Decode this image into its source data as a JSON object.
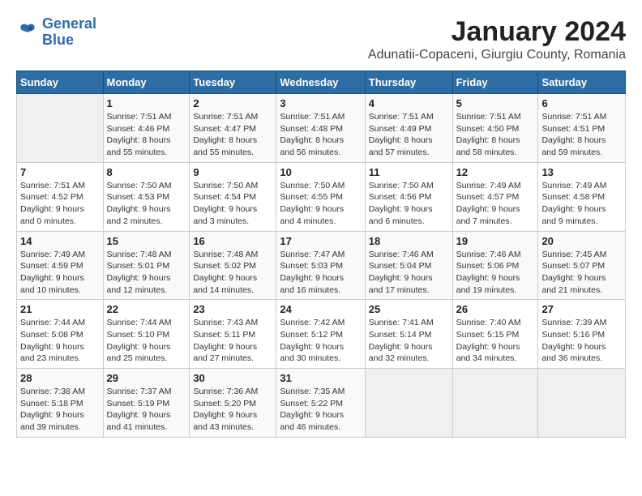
{
  "header": {
    "logo_line1": "General",
    "logo_line2": "Blue",
    "title": "January 2024",
    "subtitle": "Adunatii-Copaceni, Giurgiu County, Romania"
  },
  "weekdays": [
    "Sunday",
    "Monday",
    "Tuesday",
    "Wednesday",
    "Thursday",
    "Friday",
    "Saturday"
  ],
  "weeks": [
    [
      {
        "day": "",
        "info": ""
      },
      {
        "day": "1",
        "info": "Sunrise: 7:51 AM\nSunset: 4:46 PM\nDaylight: 8 hours\nand 55 minutes."
      },
      {
        "day": "2",
        "info": "Sunrise: 7:51 AM\nSunset: 4:47 PM\nDaylight: 8 hours\nand 55 minutes."
      },
      {
        "day": "3",
        "info": "Sunrise: 7:51 AM\nSunset: 4:48 PM\nDaylight: 8 hours\nand 56 minutes."
      },
      {
        "day": "4",
        "info": "Sunrise: 7:51 AM\nSunset: 4:49 PM\nDaylight: 8 hours\nand 57 minutes."
      },
      {
        "day": "5",
        "info": "Sunrise: 7:51 AM\nSunset: 4:50 PM\nDaylight: 8 hours\nand 58 minutes."
      },
      {
        "day": "6",
        "info": "Sunrise: 7:51 AM\nSunset: 4:51 PM\nDaylight: 8 hours\nand 59 minutes."
      }
    ],
    [
      {
        "day": "7",
        "info": "Sunrise: 7:51 AM\nSunset: 4:52 PM\nDaylight: 9 hours\nand 0 minutes."
      },
      {
        "day": "8",
        "info": "Sunrise: 7:50 AM\nSunset: 4:53 PM\nDaylight: 9 hours\nand 2 minutes."
      },
      {
        "day": "9",
        "info": "Sunrise: 7:50 AM\nSunset: 4:54 PM\nDaylight: 9 hours\nand 3 minutes."
      },
      {
        "day": "10",
        "info": "Sunrise: 7:50 AM\nSunset: 4:55 PM\nDaylight: 9 hours\nand 4 minutes."
      },
      {
        "day": "11",
        "info": "Sunrise: 7:50 AM\nSunset: 4:56 PM\nDaylight: 9 hours\nand 6 minutes."
      },
      {
        "day": "12",
        "info": "Sunrise: 7:49 AM\nSunset: 4:57 PM\nDaylight: 9 hours\nand 7 minutes."
      },
      {
        "day": "13",
        "info": "Sunrise: 7:49 AM\nSunset: 4:58 PM\nDaylight: 9 hours\nand 9 minutes."
      }
    ],
    [
      {
        "day": "14",
        "info": "Sunrise: 7:49 AM\nSunset: 4:59 PM\nDaylight: 9 hours\nand 10 minutes."
      },
      {
        "day": "15",
        "info": "Sunrise: 7:48 AM\nSunset: 5:01 PM\nDaylight: 9 hours\nand 12 minutes."
      },
      {
        "day": "16",
        "info": "Sunrise: 7:48 AM\nSunset: 5:02 PM\nDaylight: 9 hours\nand 14 minutes."
      },
      {
        "day": "17",
        "info": "Sunrise: 7:47 AM\nSunset: 5:03 PM\nDaylight: 9 hours\nand 16 minutes."
      },
      {
        "day": "18",
        "info": "Sunrise: 7:46 AM\nSunset: 5:04 PM\nDaylight: 9 hours\nand 17 minutes."
      },
      {
        "day": "19",
        "info": "Sunrise: 7:46 AM\nSunset: 5:06 PM\nDaylight: 9 hours\nand 19 minutes."
      },
      {
        "day": "20",
        "info": "Sunrise: 7:45 AM\nSunset: 5:07 PM\nDaylight: 9 hours\nand 21 minutes."
      }
    ],
    [
      {
        "day": "21",
        "info": "Sunrise: 7:44 AM\nSunset: 5:08 PM\nDaylight: 9 hours\nand 23 minutes."
      },
      {
        "day": "22",
        "info": "Sunrise: 7:44 AM\nSunset: 5:10 PM\nDaylight: 9 hours\nand 25 minutes."
      },
      {
        "day": "23",
        "info": "Sunrise: 7:43 AM\nSunset: 5:11 PM\nDaylight: 9 hours\nand 27 minutes."
      },
      {
        "day": "24",
        "info": "Sunrise: 7:42 AM\nSunset: 5:12 PM\nDaylight: 9 hours\nand 30 minutes."
      },
      {
        "day": "25",
        "info": "Sunrise: 7:41 AM\nSunset: 5:14 PM\nDaylight: 9 hours\nand 32 minutes."
      },
      {
        "day": "26",
        "info": "Sunrise: 7:40 AM\nSunset: 5:15 PM\nDaylight: 9 hours\nand 34 minutes."
      },
      {
        "day": "27",
        "info": "Sunrise: 7:39 AM\nSunset: 5:16 PM\nDaylight: 9 hours\nand 36 minutes."
      }
    ],
    [
      {
        "day": "28",
        "info": "Sunrise: 7:38 AM\nSunset: 5:18 PM\nDaylight: 9 hours\nand 39 minutes."
      },
      {
        "day": "29",
        "info": "Sunrise: 7:37 AM\nSunset: 5:19 PM\nDaylight: 9 hours\nand 41 minutes."
      },
      {
        "day": "30",
        "info": "Sunrise: 7:36 AM\nSunset: 5:20 PM\nDaylight: 9 hours\nand 43 minutes."
      },
      {
        "day": "31",
        "info": "Sunrise: 7:35 AM\nSunset: 5:22 PM\nDaylight: 9 hours\nand 46 minutes."
      },
      {
        "day": "",
        "info": ""
      },
      {
        "day": "",
        "info": ""
      },
      {
        "day": "",
        "info": ""
      }
    ]
  ]
}
